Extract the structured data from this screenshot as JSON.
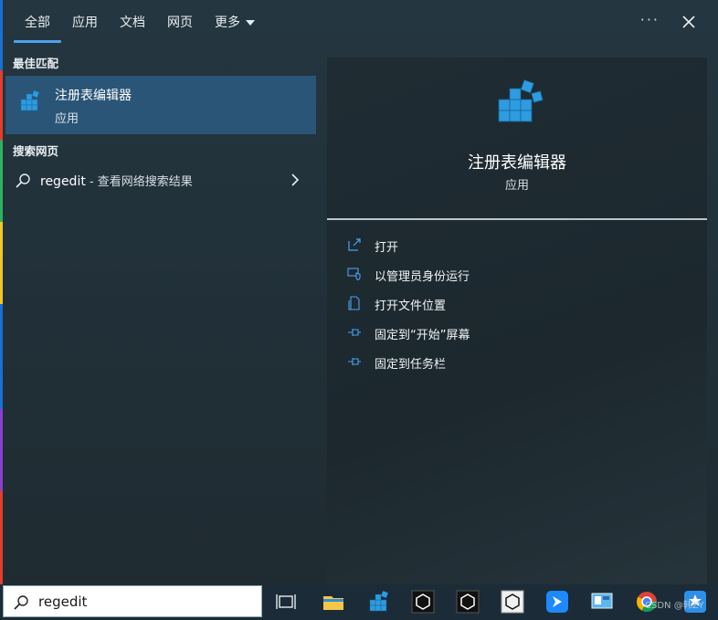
{
  "tabs": [
    {
      "label": "全部",
      "active": true
    },
    {
      "label": "应用",
      "active": false
    },
    {
      "label": "文档",
      "active": false
    },
    {
      "label": "网页",
      "active": false
    },
    {
      "label": "更多",
      "active": false
    }
  ],
  "topbar": {
    "options_glyph": "···"
  },
  "sections": {
    "best_match": "最佳匹配",
    "web_search": "搜索网页"
  },
  "best_match": {
    "title": "注册表编辑器",
    "subtitle": "应用",
    "icon": "registry-editor-icon"
  },
  "web_result": {
    "query": "regedit",
    "suffix": " - 查看网络搜索结果",
    "icon": "search-icon"
  },
  "detail": {
    "title": "注册表编辑器",
    "subtitle": "应用",
    "actions": [
      {
        "label": "打开",
        "icon": "open-icon"
      },
      {
        "label": "以管理员身份运行",
        "icon": "shield-icon"
      },
      {
        "label": "打开文件位置",
        "icon": "file-location-icon"
      },
      {
        "label": "固定到“开始”屏幕",
        "icon": "pin-icon"
      },
      {
        "label": "固定到任务栏",
        "icon": "pin-icon"
      }
    ]
  },
  "taskbar": {
    "search_value": "regedit",
    "icons": [
      "task-view-icon",
      "file-explorer-icon",
      "registry-editor-icon",
      "unity-icon",
      "unity-icon",
      "unity-icon",
      "feishu-icon",
      "control-panel-icon",
      "chrome-icon",
      "app-icon"
    ],
    "watermark": "CSDN @韩ZY"
  },
  "colors": {
    "accent": "#4aa3f0",
    "selected_row": "#2a5577",
    "icon_blue": "#2f9be0"
  }
}
